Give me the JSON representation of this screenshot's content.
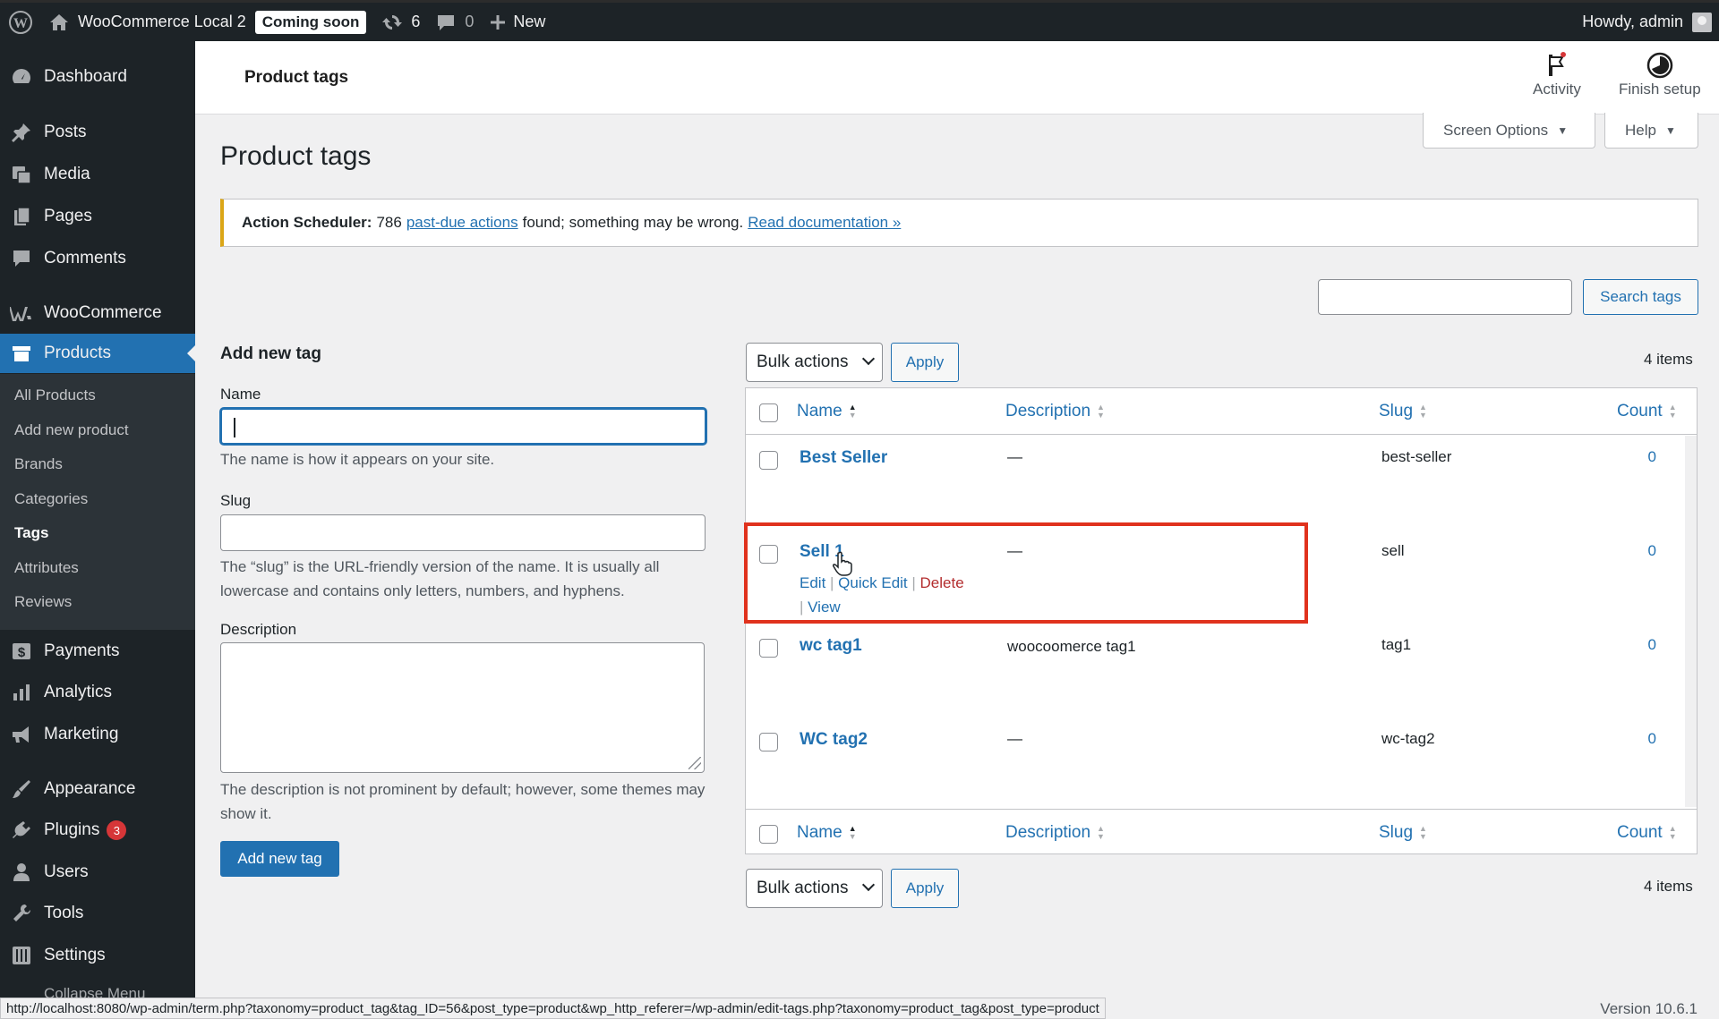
{
  "admin_bar": {
    "site_name": "WooCommerce Local 2",
    "coming_soon": "Coming soon",
    "updates_count": "6",
    "comments_count": "0",
    "new_label": "New",
    "howdy": "Howdy, admin"
  },
  "sidebar": {
    "items": [
      {
        "label": "Dashboard",
        "icon": "dashboard-icon"
      },
      {
        "label": "Posts",
        "icon": "pin-icon"
      },
      {
        "label": "Media",
        "icon": "media-icon"
      },
      {
        "label": "Pages",
        "icon": "pages-icon"
      },
      {
        "label": "Comments",
        "icon": "comment-icon"
      },
      {
        "label": "WooCommerce",
        "icon": "woo-icon"
      },
      {
        "label": "Products",
        "icon": "products-icon"
      },
      {
        "label": "Payments",
        "icon": "payments-icon"
      },
      {
        "label": "Analytics",
        "icon": "analytics-icon"
      },
      {
        "label": "Marketing",
        "icon": "marketing-icon"
      },
      {
        "label": "Appearance",
        "icon": "brush-icon"
      },
      {
        "label": "Plugins",
        "icon": "plugin-icon",
        "badge": "3"
      },
      {
        "label": "Users",
        "icon": "users-icon"
      },
      {
        "label": "Tools",
        "icon": "wrench-icon"
      },
      {
        "label": "Settings",
        "icon": "settings-icon"
      }
    ],
    "submenu": [
      "All Products",
      "Add new product",
      "Brands",
      "Categories",
      "Tags",
      "Attributes",
      "Reviews"
    ],
    "collapse_label": "Collapse Menu"
  },
  "header": {
    "title": "Product tags",
    "activity": "Activity",
    "finish_setup": "Finish setup"
  },
  "screen_options": "Screen Options",
  "help": "Help",
  "page_title": "Product tags",
  "notice": {
    "strong": "Action Scheduler:",
    "count": "786",
    "link1": "past-due actions",
    "mid": "found; something may be wrong.",
    "link2": "Read documentation »"
  },
  "search": {
    "button": "Search tags",
    "value": ""
  },
  "form": {
    "heading": "Add new tag",
    "name_label": "Name",
    "name_help": "The name is how it appears on your site.",
    "slug_label": "Slug",
    "slug_help": "The “slug” is the URL-friendly version of the name. It is usually all lowercase and contains only letters, numbers, and hyphens.",
    "desc_label": "Description",
    "desc_help": "The description is not prominent by default; however, some themes may show it.",
    "submit": "Add new tag"
  },
  "table": {
    "bulk_actions": "Bulk actions",
    "apply": "Apply",
    "items_count": "4 items",
    "columns": [
      "Name",
      "Description",
      "Slug",
      "Count"
    ],
    "rows": [
      {
        "name": "Best Seller",
        "description": "—",
        "slug": "best-seller",
        "count": "0"
      },
      {
        "name": "Sell 1",
        "description": "—",
        "slug": "sell",
        "count": "0"
      },
      {
        "name": "wc tag1",
        "description": "woocoomerce tag1",
        "slug": "tag1",
        "count": "0"
      },
      {
        "name": "WC tag2",
        "description": "—",
        "slug": "wc-tag2",
        "count": "0"
      }
    ],
    "row_actions": {
      "edit": "Edit",
      "quick_edit": "Quick Edit",
      "delete": "Delete",
      "view": "View"
    }
  },
  "status_url": "http://localhost:8080/wp-admin/term.php?taxonomy=product_tag&tag_ID=56&post_type=product&wp_http_referer=/wp-admin/edit-tags.php?taxonomy=product_tag&post_type=product",
  "version": "Version 10.6.1",
  "colors": {
    "accent": "#2271b1",
    "sidebar": "#1d2327",
    "notice": "#dba617",
    "highlight": "#e0321d",
    "delete": "#b32d2e"
  }
}
